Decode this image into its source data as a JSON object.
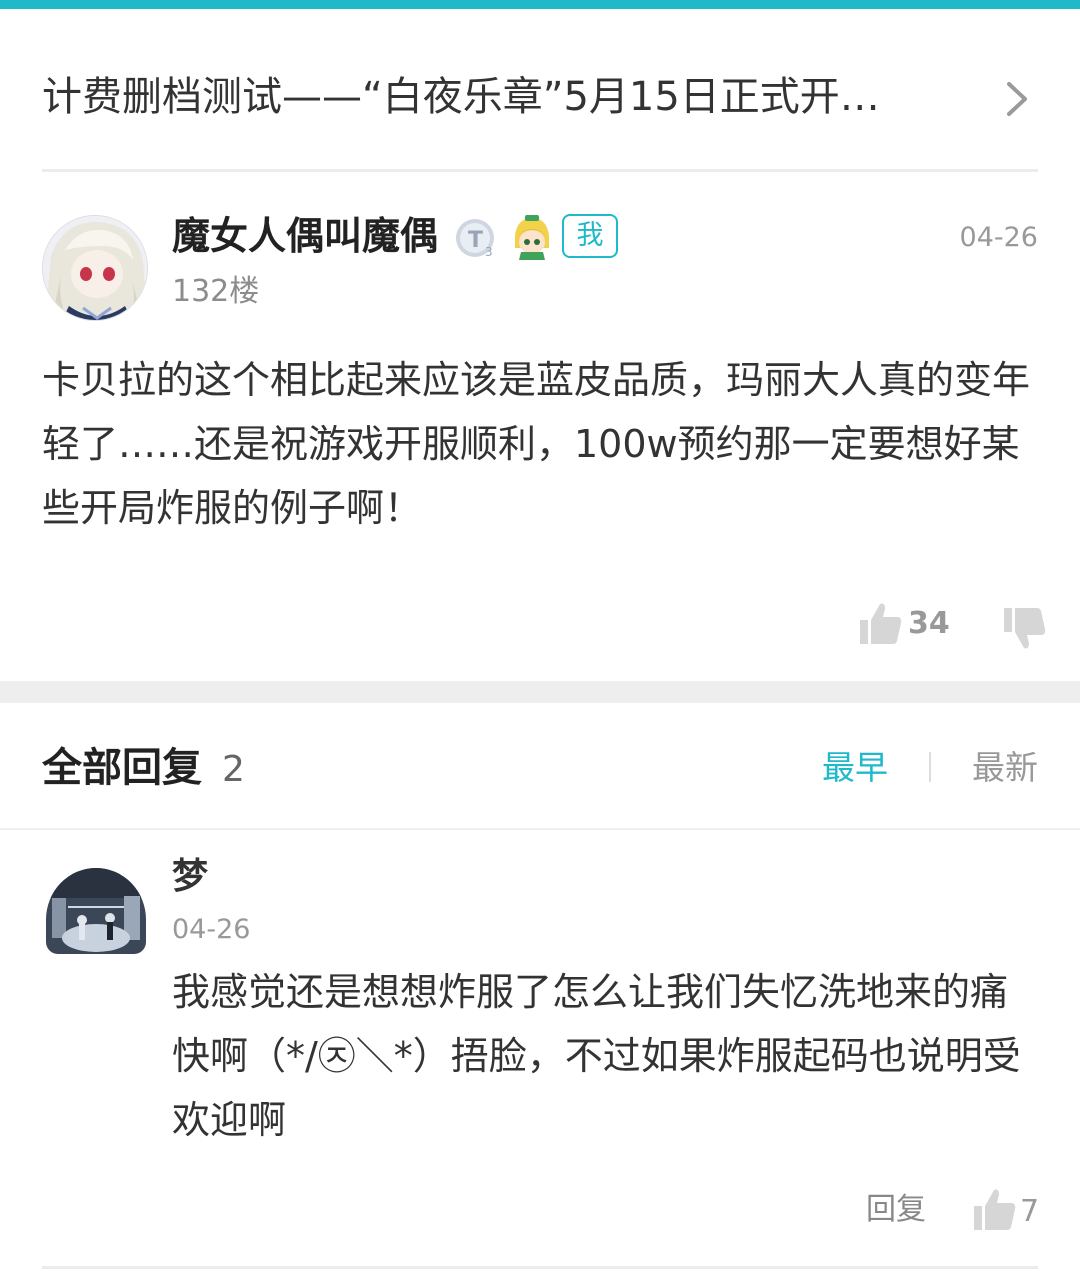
{
  "thread": {
    "title": "计费删档测试——“白夜乐章”5月15日正式开…"
  },
  "post": {
    "author": "魔女人偶叫魔偶",
    "level_icon": "level-t3-badge-icon",
    "me_badge": "我",
    "date": "04-26",
    "floor": "132楼",
    "body": "卡贝拉的这个相比起来应该是蓝皮品质，玛丽大人真的变年轻了……还是祝游戏开服顺利，100w预约那一定要想好某些开局炸服的例子啊！",
    "likes": "34"
  },
  "replies": {
    "title": "全部回复",
    "count": "2",
    "sort_earliest": "最早",
    "sort_newest": "最新",
    "items": [
      {
        "author": "梦",
        "date": "04-26",
        "body": "我感觉还是想想炸服了怎么让我们失忆洗地来的痛快啊（*/㉨＼*）捂脸，不过如果炸服起码也说明受欢迎啊",
        "reply_label": "回复",
        "likes": "7"
      }
    ]
  },
  "colors": {
    "accent": "#1fb9c9",
    "muted": "#999999",
    "text": "#333333"
  }
}
